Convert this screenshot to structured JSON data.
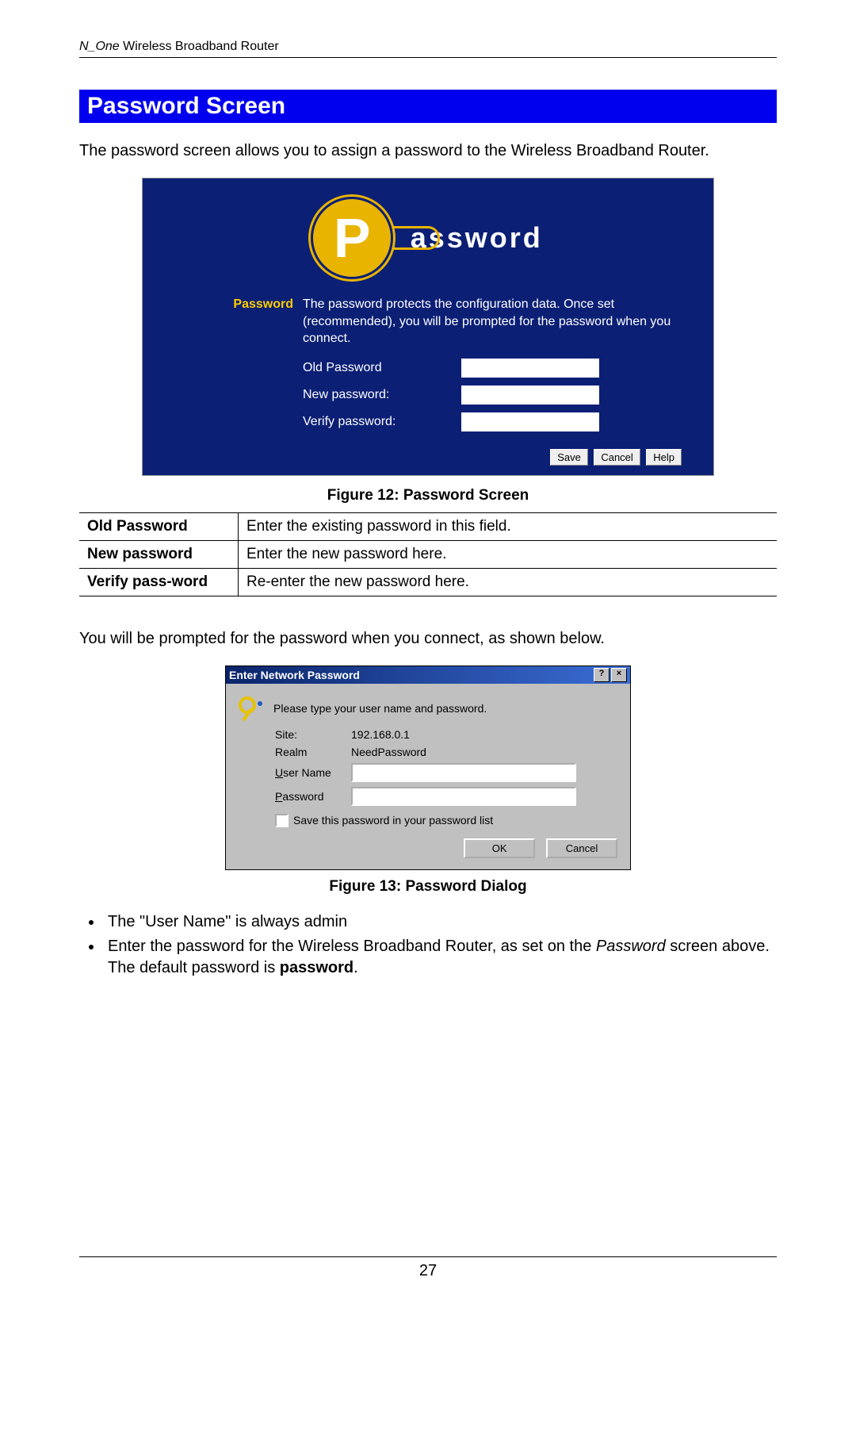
{
  "header": {
    "brand_italic": "N_One",
    "brand_rest": " Wireless Broadband Router"
  },
  "section_title": "Password Screen",
  "intro": "The password screen allows you to assign a password to the Wireless Broadband Router.",
  "figure12": {
    "logo_letter": "P",
    "logo_text": "assword",
    "side_label": "Password",
    "description": "The password protects the configuration data. Once set (recommended), you will be prompted for the password when you connect.",
    "fields": {
      "old_label": "Old Password",
      "new_label": "New password:",
      "verify_label": "Verify password:"
    },
    "buttons": {
      "save": "Save",
      "cancel": "Cancel",
      "help": "Help"
    },
    "caption": "Figure 12: Password Screen"
  },
  "desc_table": [
    {
      "name": "Old Password",
      "desc": "Enter the existing password in this field."
    },
    {
      "name": "New password",
      "desc": "Enter the new password here."
    },
    {
      "name": "Verify pass-word",
      "desc": "Re-enter the new password here."
    }
  ],
  "prompt_text": "You will be prompted for the password when you connect, as shown below.",
  "figure13": {
    "title": "Enter Network Password",
    "instruction": "Please type your user name and password.",
    "site_label": "Site:",
    "site_value": "192.168.0.1",
    "realm_label": "Realm",
    "realm_value": "NeedPassword",
    "user_label_pre": "U",
    "user_label_rest": "ser Name",
    "pass_label_pre": "P",
    "pass_label_rest": "assword",
    "save_checkbox_pre": "S",
    "save_checkbox_rest": "ave this password in your password list",
    "ok": "OK",
    "cancel": "Cancel",
    "caption": "Figure 13: Password Dialog"
  },
  "bullets": {
    "b1": "The \"User Name\" is always admin",
    "b2_pre": "Enter the password for the Wireless Broadband Router, as set on the ",
    "b2_italic": "Password",
    "b2_mid": " screen above. The default password is ",
    "b2_bold": "password",
    "b2_end": "."
  },
  "page_number": "27"
}
